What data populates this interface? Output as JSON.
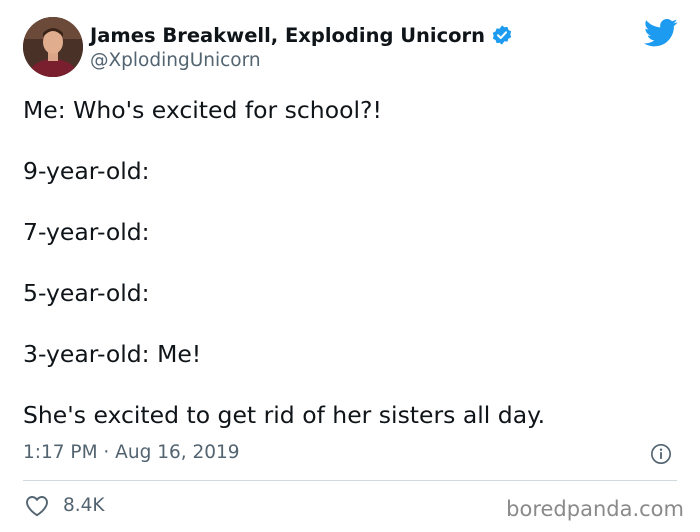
{
  "author": {
    "display_name": "James Breakwell, Exploding Unicorn",
    "handle": "@XplodingUnicorn",
    "verified": true
  },
  "tweet": {
    "lines": [
      "Me: Who's excited for school?!",
      "9-year-old:",
      "7-year-old:",
      "5-year-old:",
      "3-year-old: Me!",
      "She's excited to get rid of her sisters all day."
    ],
    "timestamp": "1:17 PM · Aug 16, 2019",
    "likes": "8.4K"
  },
  "watermark": "boredpanda.com",
  "colors": {
    "twitter_blue": "#1d9bf0",
    "text": "#0f1419",
    "muted": "#536471"
  },
  "icons": [
    "verified-badge-icon",
    "twitter-bird-icon",
    "info-icon",
    "heart-icon"
  ]
}
